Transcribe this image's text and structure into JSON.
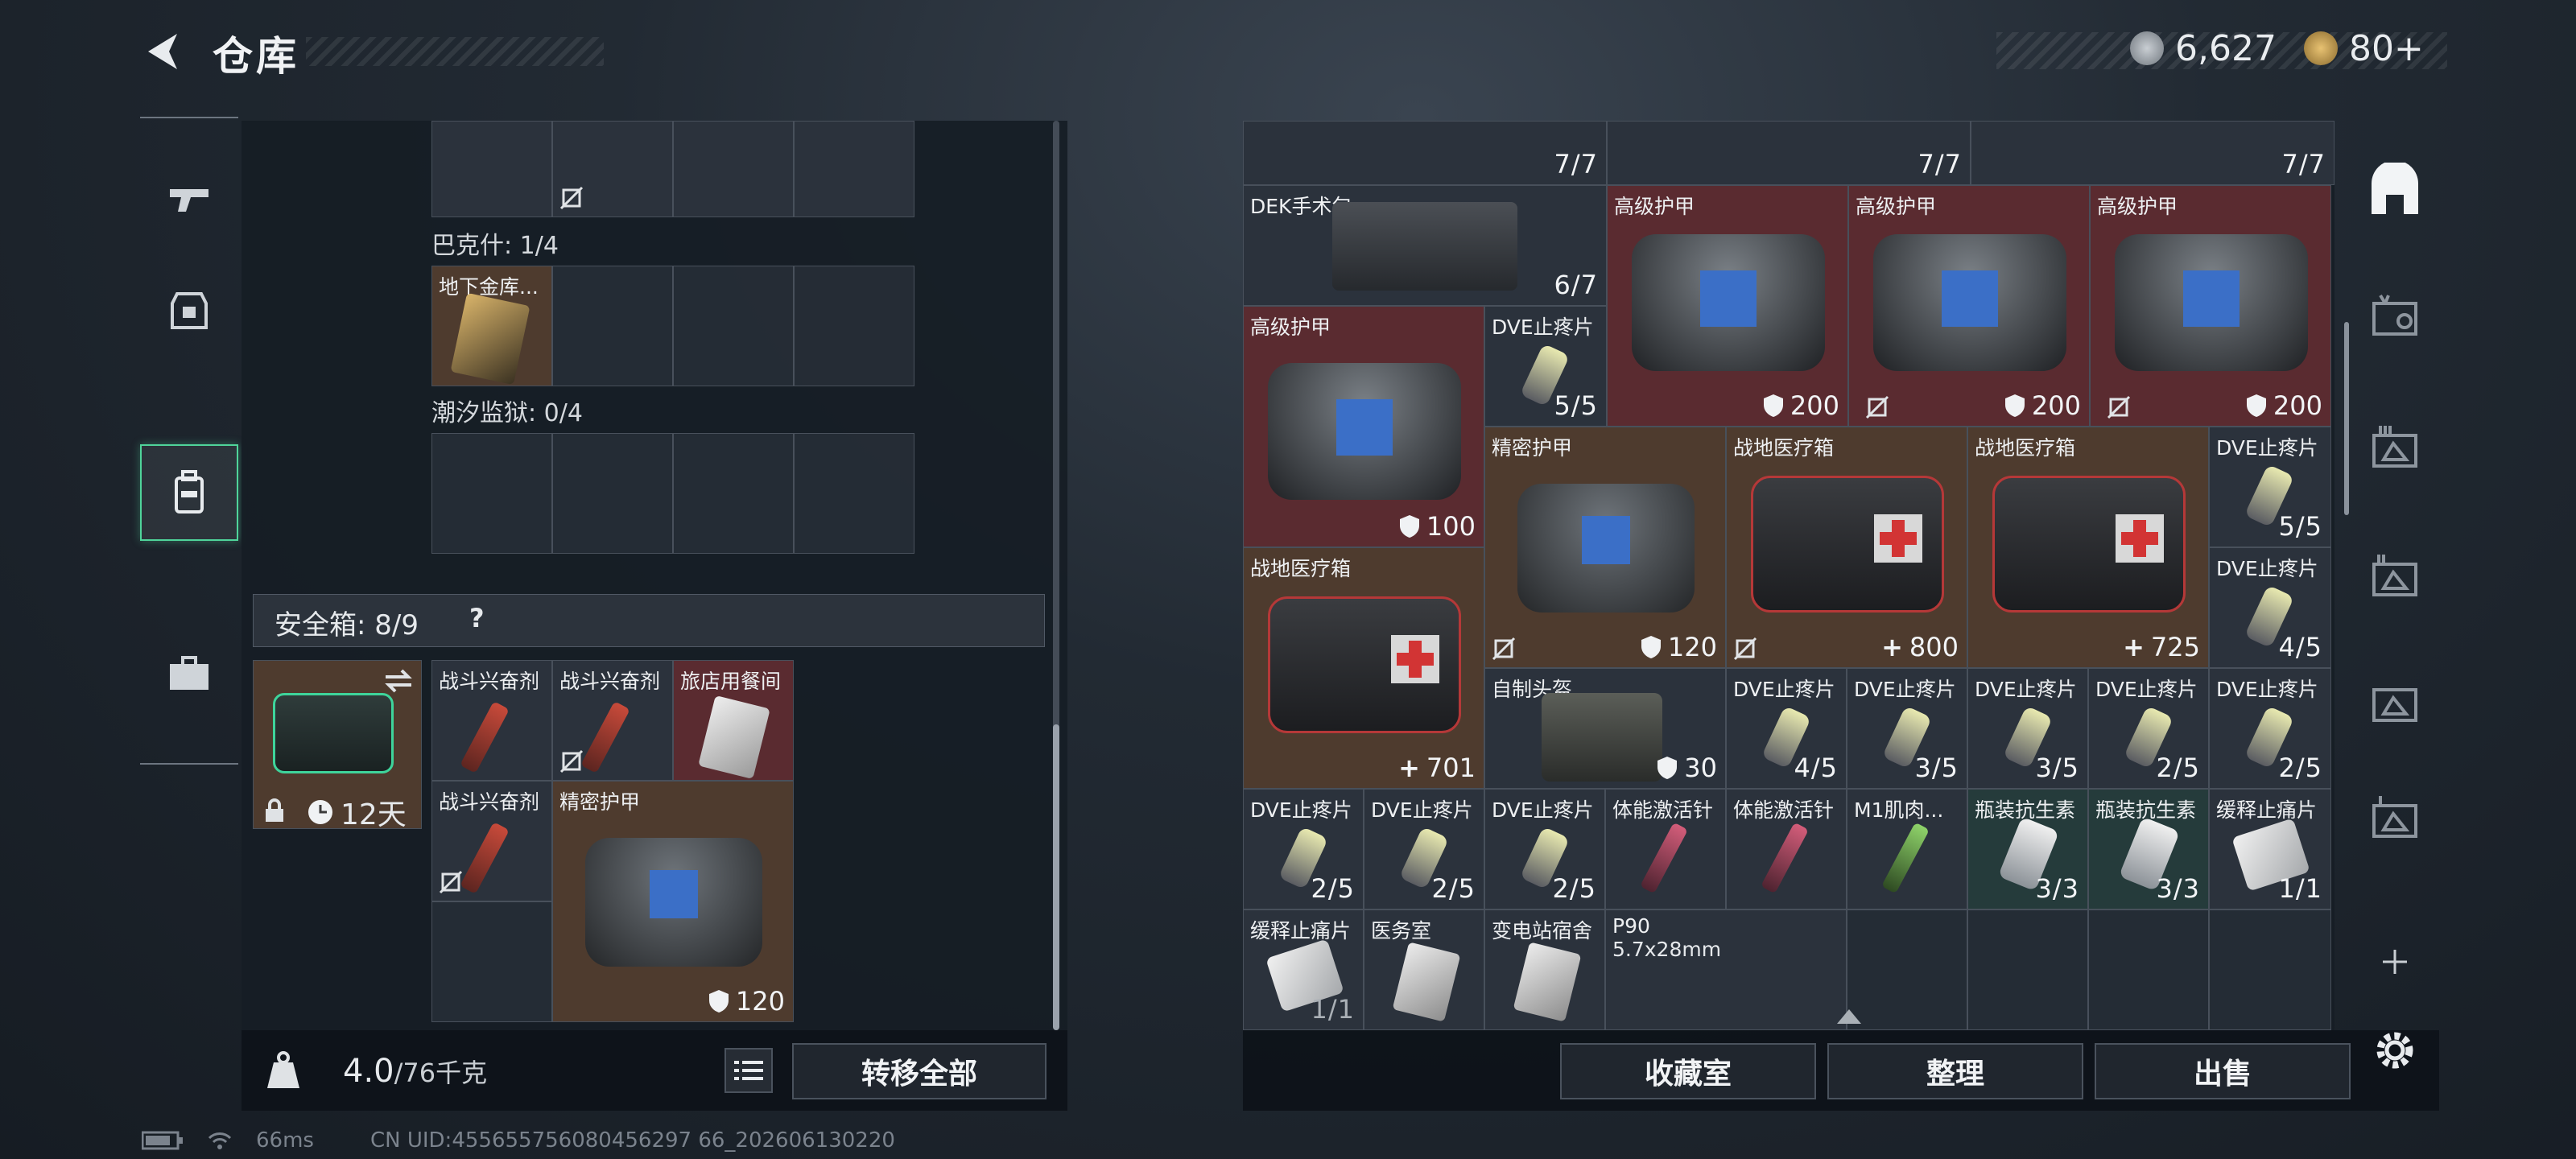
{
  "header": {
    "title": "仓库",
    "currency_primary": "6,627",
    "currency_secondary": "80+"
  },
  "left": {
    "section1_label": "巴克什: 1/4",
    "section2_label": "潮汐监狱: 0/4",
    "bakeshi_item": "地下金库...",
    "safe_box_label": "安全箱: 8/9",
    "safe_help": "?",
    "safe_box_timer": "12天",
    "safe_items": [
      {
        "label": "战斗兴奋剂"
      },
      {
        "label": "战斗兴奋剂"
      },
      {
        "label": "旅店用餐间"
      },
      {
        "label": "战斗兴奋剂"
      },
      {
        "label": "精密护甲",
        "value": "120"
      }
    ],
    "weight": "4.0",
    "weight_max": "/76千克",
    "transfer_all": "转移全部"
  },
  "right": {
    "top_counts": [
      "7/7",
      "7/7",
      "7/7"
    ],
    "items": [
      {
        "label": "DEK手术包",
        "value": "6/7"
      },
      {
        "label": "高级护甲",
        "value": ""
      },
      {
        "label": "高级护甲",
        "value": ""
      },
      {
        "label": "高级护甲",
        "value": ""
      },
      {
        "label": "高级护甲",
        "value": "100"
      },
      {
        "label": "DVE止疼片",
        "value": "5/5"
      },
      {
        "label": "",
        "value": "200"
      },
      {
        "label": "",
        "value": "200"
      },
      {
        "label": "",
        "value": "200"
      },
      {
        "label": "精密护甲",
        "value": "120"
      },
      {
        "label": "战地医疗箱",
        "value": "800"
      },
      {
        "label": "战地医疗箱",
        "value": "725"
      },
      {
        "label": "DVE止疼片",
        "value": "5/5"
      },
      {
        "label": "DVE止疼片",
        "value": "4/5"
      },
      {
        "label": "战地医疗箱",
        "value": "701"
      },
      {
        "label": "自制头盔",
        "value": "30"
      },
      {
        "label": "DVE止疼片",
        "value": "4/5"
      },
      {
        "label": "DVE止疼片",
        "value": "3/5"
      },
      {
        "label": "DVE止疼片",
        "value": "3/5"
      },
      {
        "label": "DVE止疼片",
        "value": "2/5"
      },
      {
        "label": "DVE止疼片",
        "value": "2/5"
      },
      {
        "label": "DVE止疼片",
        "value": "2/5"
      },
      {
        "label": "DVE止疼片",
        "value": "2/5"
      },
      {
        "label": "DVE止疼片",
        "value": "2/5"
      },
      {
        "label": "体能激活针",
        "value": ""
      },
      {
        "label": "体能激活针",
        "value": ""
      },
      {
        "label": "M1肌肉...",
        "value": ""
      },
      {
        "label": "瓶装抗生素",
        "value": "3/3"
      },
      {
        "label": "瓶装抗生素",
        "value": "3/3"
      },
      {
        "label": "缓释止痛片",
        "value": "1/1"
      },
      {
        "label": "缓释止痛片",
        "value": "1/1"
      },
      {
        "label": "医务室",
        "value": ""
      },
      {
        "label": "变电站宿舍",
        "value": ""
      },
      {
        "label": "P90",
        "sub": "5.7x28mm",
        "value": ""
      }
    ],
    "buttons": {
      "collection": "收藏室",
      "sort": "整理",
      "sell": "出售"
    }
  },
  "status": {
    "ping": "66ms",
    "uid": "CN UID:455655756080456297 66_202606130220"
  }
}
